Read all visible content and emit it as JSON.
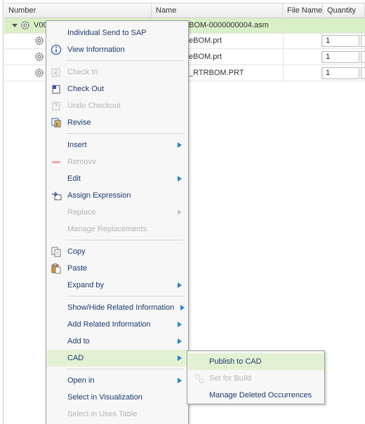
{
  "table": {
    "columns": [
      "Number",
      "Name",
      "File Name",
      "Quantity"
    ],
    "rows": [
      {
        "number": "V00",
        "name": "BOM-0000000004.asm",
        "quantity": ""
      },
      {
        "number": "",
        "name": "eBOM.prt",
        "quantity": "1"
      },
      {
        "number": "",
        "name": "eBOM.prt",
        "quantity": "1"
      },
      {
        "number": "",
        "name": "_RTRBOM.PRT",
        "quantity": "1"
      }
    ]
  },
  "context_menu": {
    "items": [
      {
        "label": "Individual Send to SAP",
        "icon": "none",
        "enabled": true
      },
      {
        "label": "View Information",
        "icon": "info-icon",
        "enabled": true
      },
      {
        "label": "Check In",
        "icon": "check-in-icon",
        "enabled": false
      },
      {
        "label": "Check Out",
        "icon": "check-out-icon",
        "enabled": true
      },
      {
        "label": "Undo Checkout",
        "icon": "undo-checkout-icon",
        "enabled": false
      },
      {
        "label": "Revise",
        "icon": "revise-icon",
        "enabled": true
      },
      {
        "label": "Insert",
        "icon": "none",
        "enabled": true,
        "submenu": true
      },
      {
        "label": "Remove",
        "icon": "remove-icon",
        "enabled": false
      },
      {
        "label": "Edit",
        "icon": "none",
        "enabled": true,
        "submenu": true
      },
      {
        "label": "Assign Expression",
        "icon": "assign-expression-icon",
        "enabled": true
      },
      {
        "label": "Replace",
        "icon": "none",
        "enabled": false,
        "submenu": true
      },
      {
        "label": "Manage Replacements",
        "icon": "none",
        "enabled": false
      },
      {
        "label": "Copy",
        "icon": "copy-icon",
        "enabled": true
      },
      {
        "label": "Paste",
        "icon": "paste-icon",
        "enabled": true
      },
      {
        "label": "Expand by",
        "icon": "none",
        "enabled": true,
        "submenu": true
      },
      {
        "label": "Show/Hide Related Information",
        "icon": "none",
        "enabled": true,
        "submenu": true
      },
      {
        "label": "Add Related Information",
        "icon": "none",
        "enabled": true,
        "submenu": true
      },
      {
        "label": "Add to",
        "icon": "none",
        "enabled": true,
        "submenu": true
      },
      {
        "label": "CAD",
        "icon": "none",
        "enabled": true,
        "submenu": true,
        "active": true
      },
      {
        "label": "Open in",
        "icon": "none",
        "enabled": true,
        "submenu": true
      },
      {
        "label": "Select in Visualization",
        "icon": "none",
        "enabled": true
      },
      {
        "label": "Select in Uses Table",
        "icon": "none",
        "enabled": false
      }
    ]
  },
  "cad_submenu": {
    "items": [
      {
        "label": "Publish to CAD",
        "icon": "none",
        "enabled": true,
        "active": true
      },
      {
        "label": "Set for Build",
        "icon": "set-for-build-icon",
        "enabled": false
      },
      {
        "label": "Manage Deleted Occurrences",
        "icon": "none",
        "enabled": true
      }
    ]
  },
  "colors": {
    "selected_row": "#d9efc6",
    "menu_text": "#1a3a6e",
    "disabled_text": "#b5b5b5",
    "submenu_arrow": "#2a7fd6",
    "active_item": "#e3f1d3"
  }
}
